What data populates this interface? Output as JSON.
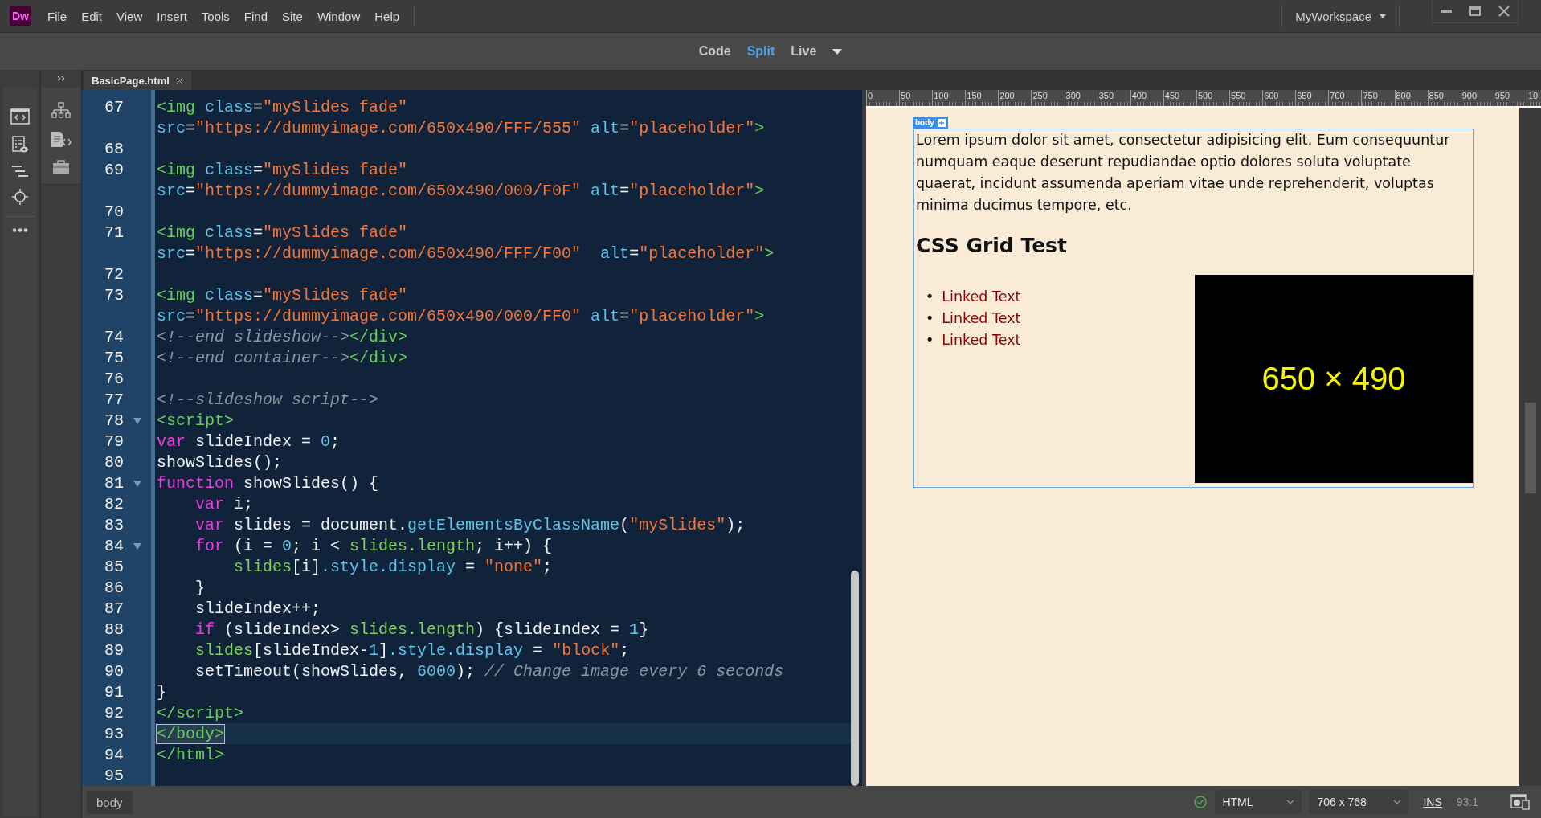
{
  "app": {
    "logo": "Dw",
    "menu": [
      "File",
      "Edit",
      "View",
      "Insert",
      "Tools",
      "Find",
      "Site",
      "Window",
      "Help"
    ]
  },
  "workspace": {
    "label": "MyWorkspace"
  },
  "view_modes": [
    {
      "label": "Code",
      "selected": false
    },
    {
      "label": "Split",
      "selected": true
    },
    {
      "label": "Live",
      "selected": false
    }
  ],
  "document_tab": {
    "label": "BasicPage.html"
  },
  "code_rows": [
    {
      "number": "67",
      "foldable": false,
      "selected": false,
      "tokens": [
        {
          "kind": "tag",
          "text": "<img"
        },
        {
          "kind": "attr",
          "text": " class"
        },
        {
          "kind": "plain",
          "text": "="
        },
        {
          "kind": "str",
          "text": "\"mySlides fade\""
        }
      ]
    },
    {
      "foldable": false,
      "selected": false,
      "tokens": [
        {
          "kind": "attr",
          "text": "src"
        },
        {
          "kind": "plain",
          "text": "="
        },
        {
          "kind": "str",
          "text": "\"https://dummyimage.com/650x490/FFF/555\""
        },
        {
          "kind": "attr",
          "text": " alt"
        },
        {
          "kind": "plain",
          "text": "="
        },
        {
          "kind": "str",
          "text": "\"placeholder\""
        },
        {
          "kind": "tag",
          "text": ">"
        }
      ]
    },
    {
      "number": "68",
      "foldable": false,
      "selected": false
    },
    {
      "number": "69",
      "foldable": false,
      "selected": false,
      "tokens": [
        {
          "kind": "tag",
          "text": "<img"
        },
        {
          "kind": "attr",
          "text": " class"
        },
        {
          "kind": "plain",
          "text": "="
        },
        {
          "kind": "str",
          "text": "\"mySlides fade\""
        }
      ]
    },
    {
      "foldable": false,
      "selected": false,
      "tokens": [
        {
          "kind": "attr",
          "text": "src"
        },
        {
          "kind": "plain",
          "text": "="
        },
        {
          "kind": "str",
          "text": "\"https://dummyimage.com/650x490/000/F0F\""
        },
        {
          "kind": "attr",
          "text": " alt"
        },
        {
          "kind": "plain",
          "text": "="
        },
        {
          "kind": "str",
          "text": "\"placeholder\""
        },
        {
          "kind": "tag",
          "text": ">"
        }
      ]
    },
    {
      "number": "70",
      "foldable": false,
      "selected": false
    },
    {
      "number": "71",
      "foldable": false,
      "selected": false,
      "tokens": [
        {
          "kind": "tag",
          "text": "<img"
        },
        {
          "kind": "attr",
          "text": " class"
        },
        {
          "kind": "plain",
          "text": "="
        },
        {
          "kind": "str",
          "text": "\"mySlides fade\""
        }
      ]
    },
    {
      "foldable": false,
      "selected": false,
      "tokens": [
        {
          "kind": "attr",
          "text": "src"
        },
        {
          "kind": "plain",
          "text": "="
        },
        {
          "kind": "str",
          "text": "\"https://dummyimage.com/650x490/FFF/F00\""
        },
        {
          "kind": "attr",
          "text": "  alt"
        },
        {
          "kind": "plain",
          "text": "="
        },
        {
          "kind": "str",
          "text": "\"placeholder\""
        },
        {
          "kind": "tag",
          "text": ">"
        }
      ]
    },
    {
      "number": "72",
      "foldable": false,
      "selected": false
    },
    {
      "number": "73",
      "foldable": false,
      "selected": false,
      "tokens": [
        {
          "kind": "tag",
          "text": "<img"
        },
        {
          "kind": "attr",
          "text": " class"
        },
        {
          "kind": "plain",
          "text": "="
        },
        {
          "kind": "str",
          "text": "\"mySlides fade\""
        }
      ]
    },
    {
      "foldable": false,
      "selected": false,
      "tokens": [
        {
          "kind": "attr",
          "text": "src"
        },
        {
          "kind": "plain",
          "text": "="
        },
        {
          "kind": "str",
          "text": "\"https://dummyimage.com/650x490/000/FF0\""
        },
        {
          "kind": "attr",
          "text": " alt"
        },
        {
          "kind": "plain",
          "text": "="
        },
        {
          "kind": "str",
          "text": "\"placeholder\""
        },
        {
          "kind": "tag",
          "text": ">"
        }
      ]
    },
    {
      "number": "74",
      "foldable": false,
      "selected": false,
      "tokens": [
        {
          "kind": "comment",
          "text": "<!--end slideshow-->"
        },
        {
          "kind": "tag",
          "text": "</div>"
        }
      ]
    },
    {
      "number": "75",
      "foldable": false,
      "selected": false,
      "tokens": [
        {
          "kind": "comment",
          "text": "<!--end container-->"
        },
        {
          "kind": "tag",
          "text": "</div>"
        }
      ]
    },
    {
      "number": "76",
      "foldable": false,
      "selected": false
    },
    {
      "number": "77",
      "foldable": false,
      "selected": false,
      "tokens": [
        {
          "kind": "comment",
          "text": "<!--slideshow script-->"
        }
      ]
    },
    {
      "number": "78",
      "foldable": true,
      "selected": false,
      "tokens": [
        {
          "kind": "tag",
          "text": "<script>"
        }
      ]
    },
    {
      "number": "79",
      "foldable": false,
      "selected": false,
      "tokens": [
        {
          "kind": "kw",
          "text": "var"
        },
        {
          "kind": "plain",
          "text": " slideIndex = "
        },
        {
          "kind": "num",
          "text": "0"
        },
        {
          "kind": "plain",
          "text": ";"
        }
      ]
    },
    {
      "number": "80",
      "foldable": false,
      "selected": false,
      "tokens": [
        {
          "kind": "plain",
          "text": "showSlides();"
        }
      ]
    },
    {
      "number": "81",
      "foldable": true,
      "selected": false,
      "tokens": [
        {
          "kind": "kw",
          "text": "function"
        },
        {
          "kind": "plain",
          "text": " showSlides() {"
        }
      ]
    },
    {
      "number": "82",
      "foldable": false,
      "selected": false,
      "tokens": [
        {
          "kind": "kw",
          "text": "    var"
        },
        {
          "kind": "plain",
          "text": " i;"
        }
      ]
    },
    {
      "number": "83",
      "foldable": false,
      "selected": false,
      "tokens": [
        {
          "kind": "kw",
          "text": "    var"
        },
        {
          "kind": "plain",
          "text": " slides = document."
        },
        {
          "kind": "fn",
          "text": "getElementsByClassName"
        },
        {
          "kind": "plain",
          "text": "("
        },
        {
          "kind": "str",
          "text": "\"mySlides\""
        },
        {
          "kind": "plain",
          "text": ");"
        }
      ]
    },
    {
      "number": "84",
      "foldable": true,
      "selected": false,
      "tokens": [
        {
          "kind": "kw",
          "text": "    for"
        },
        {
          "kind": "plain",
          "text": " (i = "
        },
        {
          "kind": "num",
          "text": "0"
        },
        {
          "kind": "plain",
          "text": "; i < "
        },
        {
          "kind": "ident",
          "text": "slides.length"
        },
        {
          "kind": "plain",
          "text": "; i++) {"
        }
      ]
    },
    {
      "number": "85",
      "foldable": false,
      "selected": false,
      "tokens": [
        {
          "kind": "ident",
          "text": "        slides"
        },
        {
          "kind": "plain",
          "text": "[i]"
        },
        {
          "kind": "fn",
          "text": ".style.display"
        },
        {
          "kind": "plain",
          "text": " = "
        },
        {
          "kind": "str",
          "text": "\"none\""
        },
        {
          "kind": "plain",
          "text": ";"
        }
      ]
    },
    {
      "number": "86",
      "foldable": false,
      "selected": false,
      "tokens": [
        {
          "kind": "plain",
          "text": "    }"
        }
      ]
    },
    {
      "number": "87",
      "foldable": false,
      "selected": false,
      "tokens": [
        {
          "kind": "plain",
          "text": "    slideIndex++;"
        }
      ]
    },
    {
      "number": "88",
      "foldable": false,
      "selected": false,
      "tokens": [
        {
          "kind": "kw",
          "text": "    if"
        },
        {
          "kind": "plain",
          "text": " (slideIndex> "
        },
        {
          "kind": "ident",
          "text": "slides.length"
        },
        {
          "kind": "plain",
          "text": ") {slideIndex = "
        },
        {
          "kind": "num",
          "text": "1"
        },
        {
          "kind": "plain",
          "text": "}"
        }
      ]
    },
    {
      "number": "89",
      "foldable": false,
      "selected": false,
      "tokens": [
        {
          "kind": "ident",
          "text": "    slides"
        },
        {
          "kind": "plain",
          "text": "[slideIndex-"
        },
        {
          "kind": "num",
          "text": "1"
        },
        {
          "kind": "plain",
          "text": "]"
        },
        {
          "kind": "fn",
          "text": ".style.display"
        },
        {
          "kind": "plain",
          "text": " = "
        },
        {
          "kind": "str",
          "text": "\"block\""
        },
        {
          "kind": "plain",
          "text": ";"
        }
      ]
    },
    {
      "number": "90",
      "foldable": false,
      "selected": false,
      "tokens": [
        {
          "kind": "plain",
          "text": "    setTimeout(showSlides, "
        },
        {
          "kind": "num",
          "text": "6000"
        },
        {
          "kind": "plain",
          "text": "); "
        },
        {
          "kind": "comment",
          "text": "// Change image every 6 seconds"
        }
      ]
    },
    {
      "number": "91",
      "foldable": false,
      "selected": false,
      "tokens": [
        {
          "kind": "plain",
          "text": "}"
        }
      ]
    },
    {
      "number": "92",
      "foldable": false,
      "selected": false,
      "tokens": [
        {
          "kind": "tag",
          "text": "</script>"
        }
      ]
    },
    {
      "number": "93",
      "foldable": false,
      "selected": true,
      "tokens": [
        {
          "kind": "tag",
          "text": "</body>"
        }
      ]
    },
    {
      "number": "94",
      "foldable": false,
      "selected": false,
      "tokens": [
        {
          "kind": "tag",
          "text": "</html>"
        }
      ]
    },
    {
      "number": "95",
      "foldable": false,
      "selected": false
    }
  ],
  "ruler": [
    "0",
    "50",
    "100",
    "150",
    "200",
    "250",
    "300",
    "350",
    "400",
    "450",
    "500",
    "550",
    "600",
    "650",
    "700",
    "750",
    "800",
    "850",
    "900",
    "950",
    "10"
  ],
  "preview": {
    "element_tag": "body",
    "paragraph": "Lorem ipsum dolor sit amet, consectetur adipisicing elit. Eum consequuntur numquam eaque deserunt repudiandae optio dolores soluta voluptate quaerat, incidunt assumenda aperiam vitae unde reprehenderit, voluptas minima ducimus tempore, etc.",
    "heading": "CSS Grid Test",
    "links": [
      {
        "marker": "•",
        "text": "Linked Text"
      },
      {
        "marker": "•",
        "text": "Linked Text"
      },
      {
        "marker": "•",
        "text": "Linked Text"
      }
    ],
    "image_text": "650 × 490"
  },
  "status_bar": {
    "breadcrumb": "body",
    "language": "HTML",
    "size": "706 x 768",
    "mode": "INS",
    "cursor": "93:1"
  }
}
